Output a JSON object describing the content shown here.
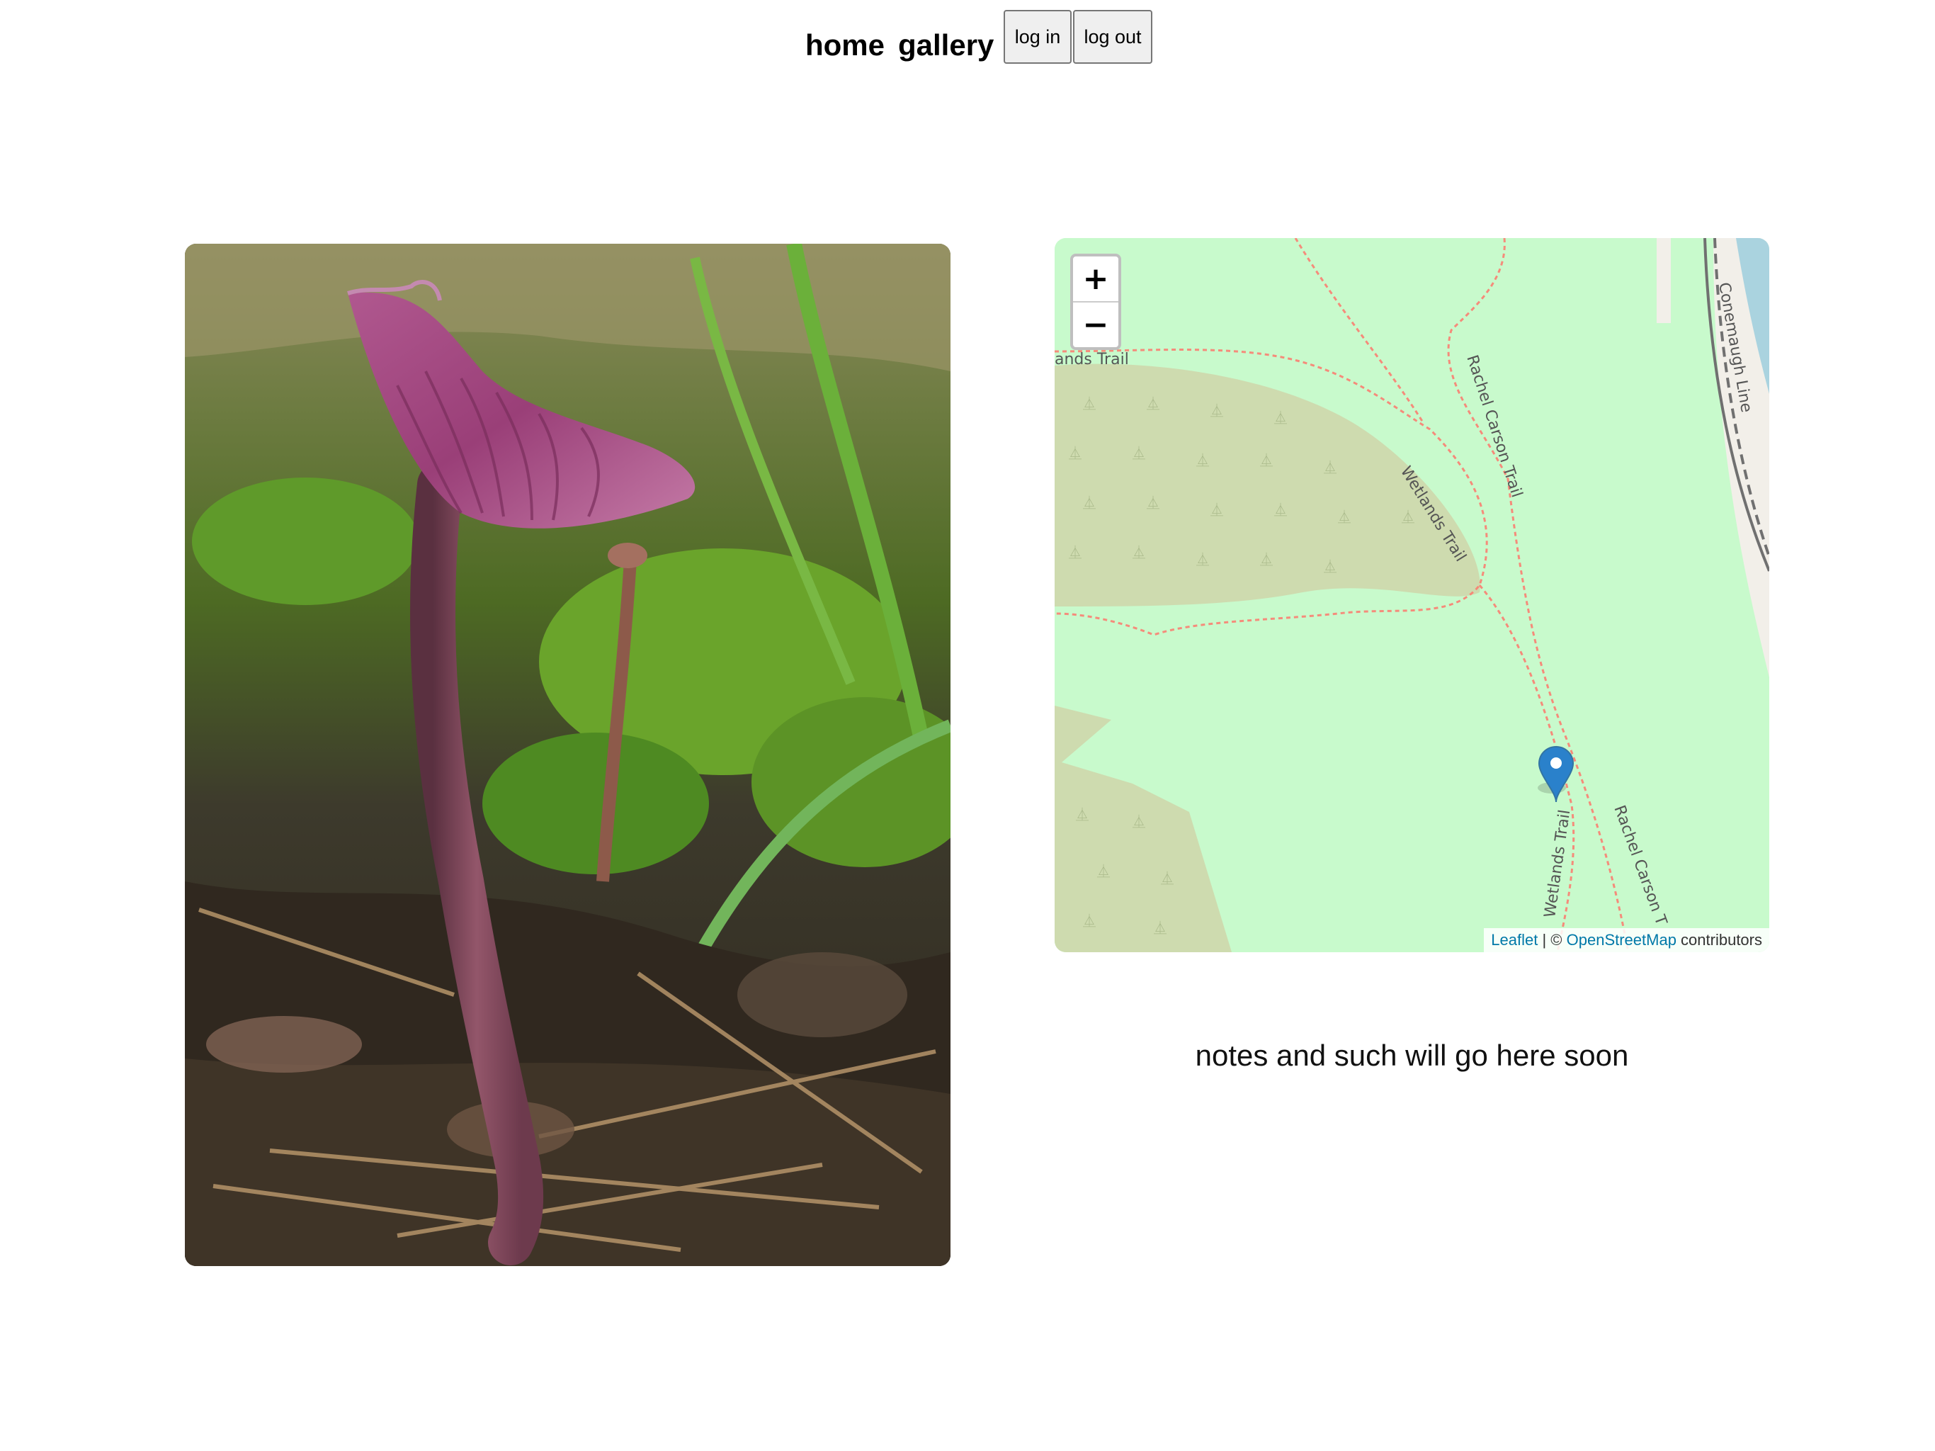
{
  "nav": {
    "home_label": "home",
    "gallery_label": "gallery",
    "login_label": "log in",
    "logout_label": "log out"
  },
  "map": {
    "zoom_in_label": "+",
    "zoom_out_label": "−",
    "trail_labels": {
      "top_left_fragment": "ands Trail",
      "rachel_carson_north": "Rachel Carson Trail",
      "wetlands_north": "Wetlands Trail",
      "conemaugh": "Conemaugh Line",
      "wetlands_south": "Wetlands Trail",
      "rachel_carson_south": "Rachel Carson T"
    },
    "attribution": {
      "leaflet": "Leaflet",
      "separator": " | © ",
      "osm": "OpenStreetMap",
      "suffix": " contributors"
    },
    "marker": "map-pin-icon",
    "colors": {
      "park": "#c8facc",
      "wood": "#cedbaf",
      "water": "#aad3df",
      "trail": "#fa8072",
      "marker": "#2a81cb",
      "link": "#0078a8"
    }
  },
  "notes": {
    "text": "notes and such will go here soon"
  }
}
